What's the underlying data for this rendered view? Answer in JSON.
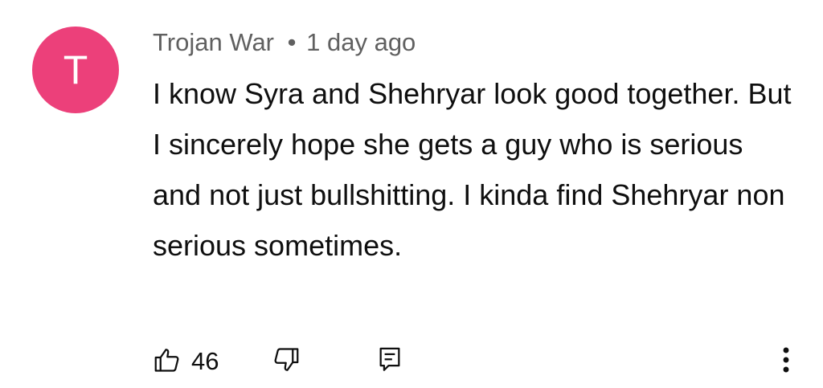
{
  "comment": {
    "avatar_letter": "T",
    "avatar_color": "#ec407a",
    "author": "Trojan War",
    "separator": "•",
    "timestamp": "1 day ago",
    "text": "I know Syra and Shehryar look good together. But I sincerely hope she gets a guy who is serious and not just bullshitting. I kinda find Shehryar non serious sometimes."
  },
  "actions": {
    "like_icon": "thumbs-up-icon",
    "like_count": "46",
    "dislike_icon": "thumbs-down-icon",
    "reply_icon": "reply-comment-icon",
    "more_icon": "more-vertical-icon"
  }
}
